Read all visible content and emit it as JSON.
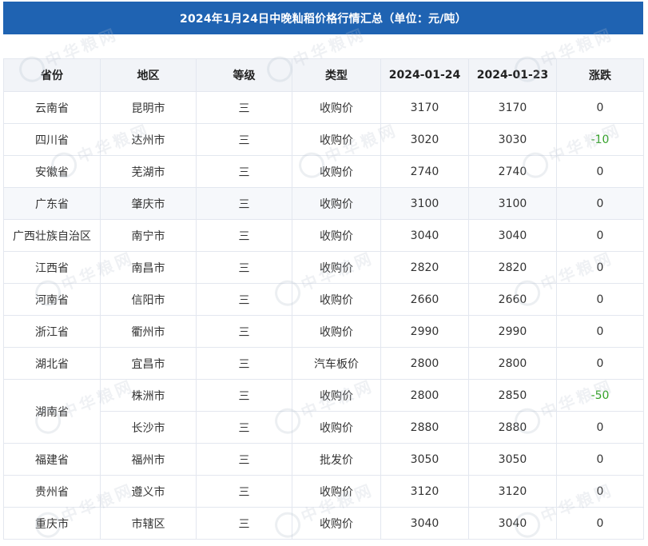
{
  "title": "2024年1月24日中晚籼稻价格行情汇总（单位：元/吨）",
  "watermark_text": "中华粮网",
  "columns": {
    "province": "省份",
    "region": "地区",
    "grade": "等级",
    "type": "类型",
    "date1": "2024-01-24",
    "date2": "2024-01-23",
    "change": "涨跌"
  },
  "rows": [
    {
      "province": "云南省",
      "region": "昆明市",
      "grade": "三",
      "type": "收购价",
      "d1": "3170",
      "d2": "3170",
      "change": "0"
    },
    {
      "province": "四川省",
      "region": "达州市",
      "grade": "三",
      "type": "收购价",
      "d1": "3020",
      "d2": "3030",
      "change": "-10"
    },
    {
      "province": "安徽省",
      "region": "芜湖市",
      "grade": "三",
      "type": "收购价",
      "d1": "2740",
      "d2": "2740",
      "change": "0"
    },
    {
      "province": "广东省",
      "region": "肇庆市",
      "grade": "三",
      "type": "收购价",
      "d1": "3100",
      "d2": "3100",
      "change": "0"
    },
    {
      "province": "广西壮族自治区",
      "region": "南宁市",
      "grade": "三",
      "type": "收购价",
      "d1": "3040",
      "d2": "3040",
      "change": "0"
    },
    {
      "province": "江西省",
      "region": "南昌市",
      "grade": "三",
      "type": "收购价",
      "d1": "2820",
      "d2": "2820",
      "change": "0"
    },
    {
      "province": "河南省",
      "region": "信阳市",
      "grade": "三",
      "type": "收购价",
      "d1": "2660",
      "d2": "2660",
      "change": "0"
    },
    {
      "province": "浙江省",
      "region": "衢州市",
      "grade": "三",
      "type": "收购价",
      "d1": "2990",
      "d2": "2990",
      "change": "0"
    },
    {
      "province": "湖北省",
      "region": "宜昌市",
      "grade": "三",
      "type": "汽车板价",
      "d1": "2800",
      "d2": "2800",
      "change": "0"
    },
    {
      "province": "湖南省",
      "region": "株洲市",
      "grade": "三",
      "type": "收购价",
      "d1": "2800",
      "d2": "2850",
      "change": "-50"
    },
    {
      "province": "",
      "region": "长沙市",
      "grade": "三",
      "type": "收购价",
      "d1": "2880",
      "d2": "2880",
      "change": "0"
    },
    {
      "province": "福建省",
      "region": "福州市",
      "grade": "三",
      "type": "批发价",
      "d1": "3050",
      "d2": "3050",
      "change": "0"
    },
    {
      "province": "贵州省",
      "region": "遵义市",
      "grade": "三",
      "type": "收购价",
      "d1": "3120",
      "d2": "3120",
      "change": "0"
    },
    {
      "province": "重庆市",
      "region": "市辖区",
      "grade": "三",
      "type": "收购价",
      "d1": "3040",
      "d2": "3040",
      "change": "0"
    }
  ],
  "colors": {
    "title_bg": "#1f63b2",
    "down": "#2ea11f"
  }
}
